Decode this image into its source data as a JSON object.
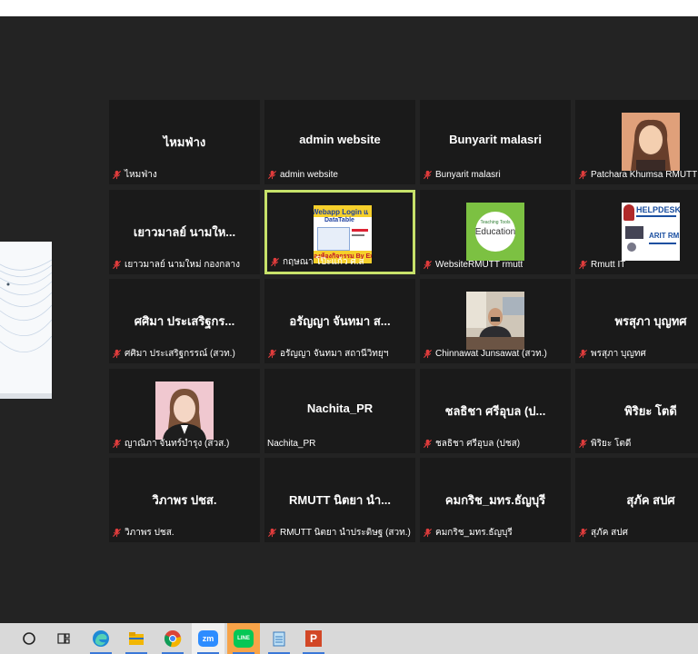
{
  "window": {
    "background": "#232323",
    "active_speaker_border": "#c7e26a"
  },
  "participants": [
    {
      "name": "ไหมฟ่าง",
      "label": "ไหมฟ่าง",
      "muted": true,
      "video": false
    },
    {
      "name": "admin website",
      "label": "admin website",
      "muted": true,
      "video": false
    },
    {
      "name": "Bunyarit malasri",
      "label": "Bunyarit malasri",
      "muted": true,
      "video": false
    },
    {
      "name": "",
      "label": "Patchara Khumsa RMUTT",
      "muted": true,
      "video": true,
      "thumb": "portrait-woman"
    },
    {
      "name": "เยาวมาลย์ นามให...",
      "label": "เยาวมาลย์ นามใหม่ กองกลาง",
      "muted": true,
      "video": false
    },
    {
      "name": "",
      "label": "กฤษณา โป๊ะแก้ว ศ.ส",
      "muted": true,
      "video": true,
      "thumb": "webapp-slide",
      "active": true,
      "thumb_text": {
        "line1": "Webapp Login แ",
        "line2": "DataTable",
        "line3": "จองห้องกิจกรรม By Ex"
      }
    },
    {
      "name": "",
      "label": "WebsiteRMUTT rmutt",
      "muted": true,
      "video": true,
      "thumb": "education-logo",
      "thumb_text": {
        "line1": "Teaching Tools",
        "line2": "Education"
      }
    },
    {
      "name": "",
      "label": "Rmutt IT",
      "muted": true,
      "video": true,
      "thumb": "helpdesk-logo",
      "thumb_text": {
        "line1": "HELPDESK",
        "line2": "ARIT RM"
      }
    },
    {
      "name": "ศศิมา ประเสริฐกร...",
      "label": "ศศิมา ประเสริฐกรรณ์ (สวท.)",
      "muted": true,
      "video": false
    },
    {
      "name": "อรัญญา จันทมา ส...",
      "label": "อรัญญา จันทมา สถานีวิทยุฯ",
      "muted": true,
      "video": false
    },
    {
      "name": "",
      "label": "Chinnawat Junsawat (สวท.)",
      "muted": true,
      "video": true,
      "thumb": "office-man"
    },
    {
      "name": "พรสุภา บุญทศ",
      "label": "พรสุภา บุญทศ",
      "muted": true,
      "video": false
    },
    {
      "name": "",
      "label": "ญาณิภา จันทร์บำรุง (สวส.)",
      "muted": true,
      "video": true,
      "thumb": "portrait-woman-pink"
    },
    {
      "name": "Nachita_PR",
      "label": "Nachita_PR",
      "muted": false,
      "video": false
    },
    {
      "name": "ชลธิชา ศรีอุบล (ป...",
      "label": "ชลธิชา ศรีอุบล (ปชส)",
      "muted": true,
      "video": false
    },
    {
      "name": "พิริยะ โตดี",
      "label": "พิริยะ โตดี",
      "muted": true,
      "video": false
    },
    {
      "name": "วิภาพร ปชส.",
      "label": "วิภาพร ปชส.",
      "muted": true,
      "video": false
    },
    {
      "name": "RMUTT นิตยา นำ...",
      "label": "RMUTT นิตยา นำประดิษฐ (สวท.)",
      "muted": true,
      "video": false
    },
    {
      "name": "คมกริช_มทร.ธัญบุรี",
      "label": "คมกริช_มทร.ธัญบุรี",
      "muted": true,
      "video": false
    },
    {
      "name": "สุภัค สปศ",
      "label": "สุภัค สปศ",
      "muted": true,
      "video": false
    }
  ],
  "taskbar": {
    "items": [
      {
        "name": "cortana-icon"
      },
      {
        "name": "task-view-icon"
      },
      {
        "name": "edge-icon"
      },
      {
        "name": "file-explorer-icon"
      },
      {
        "name": "chrome-icon"
      },
      {
        "name": "zoom-icon",
        "text": "zm"
      },
      {
        "name": "line-icon",
        "text": "LINE"
      },
      {
        "name": "notepad-icon"
      },
      {
        "name": "powerpoint-icon",
        "text": "P"
      }
    ]
  }
}
